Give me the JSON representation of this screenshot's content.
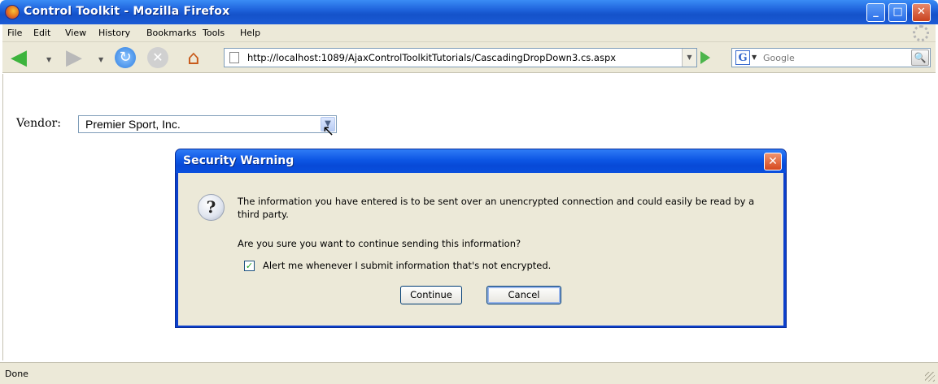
{
  "window": {
    "title": "Control Toolkit - Mozilla Firefox",
    "minimize_icon": "minimize-icon",
    "maximize_icon": "maximize-icon",
    "close_icon": "close-icon"
  },
  "menubar": {
    "items": [
      "File",
      "Edit",
      "View",
      "History",
      "Bookmarks",
      "Tools",
      "Help"
    ]
  },
  "toolbar": {
    "url": "http://localhost:1089/AjaxControlToolkitTutorials/CascadingDropDown3.cs.aspx",
    "search_placeholder": "Google"
  },
  "page": {
    "vendor_label": "Vendor:",
    "vendor_value": "Premier Sport, Inc."
  },
  "dialog": {
    "title": "Security Warning",
    "message": "The information you have entered is to be sent over an unencrypted connection and could easily be read by a third party.",
    "question": "Are you sure you want to continue sending this information?",
    "checkbox_label": "Alert me whenever I submit information that's not encrypted.",
    "checkbox_checked": true,
    "continue_label": "Continue",
    "cancel_label": "Cancel"
  },
  "statusbar": {
    "text": "Done"
  }
}
